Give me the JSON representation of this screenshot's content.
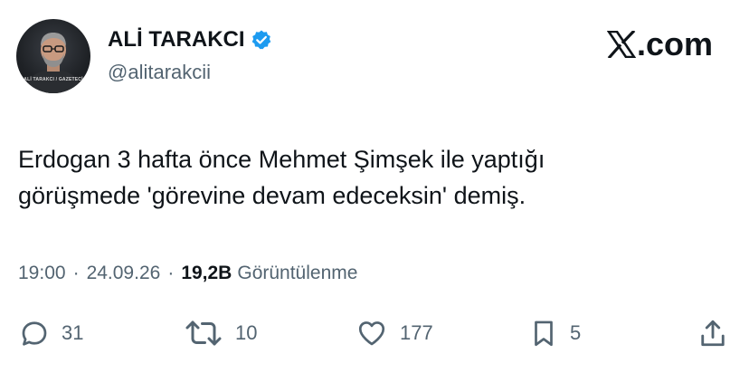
{
  "author": {
    "display_name": "ALİ TARAKCI",
    "handle": "@alitarakcii",
    "avatar_caption": "ALİ TARAKCI / GAZETECİ",
    "verified": true
  },
  "brand": {
    "logo_text": ".com",
    "logo_icon": "x-logo-icon"
  },
  "tweet": {
    "text_line1": "Erdogan 3 hafta önce Mehmet Şimşek ile yaptığı",
    "text_line2": "görüşmede 'görevine devam edeceksin' demiş."
  },
  "meta": {
    "time": "19:00",
    "separator": "·",
    "date": "24.09.26",
    "views_count": "19,2B",
    "views_label": "Görüntülenme"
  },
  "actions": {
    "replies": "31",
    "retweets": "10",
    "likes": "177",
    "bookmarks": "5"
  },
  "colors": {
    "text": "#0f1419",
    "secondary": "#536471",
    "verified": "#1d9bf0"
  }
}
